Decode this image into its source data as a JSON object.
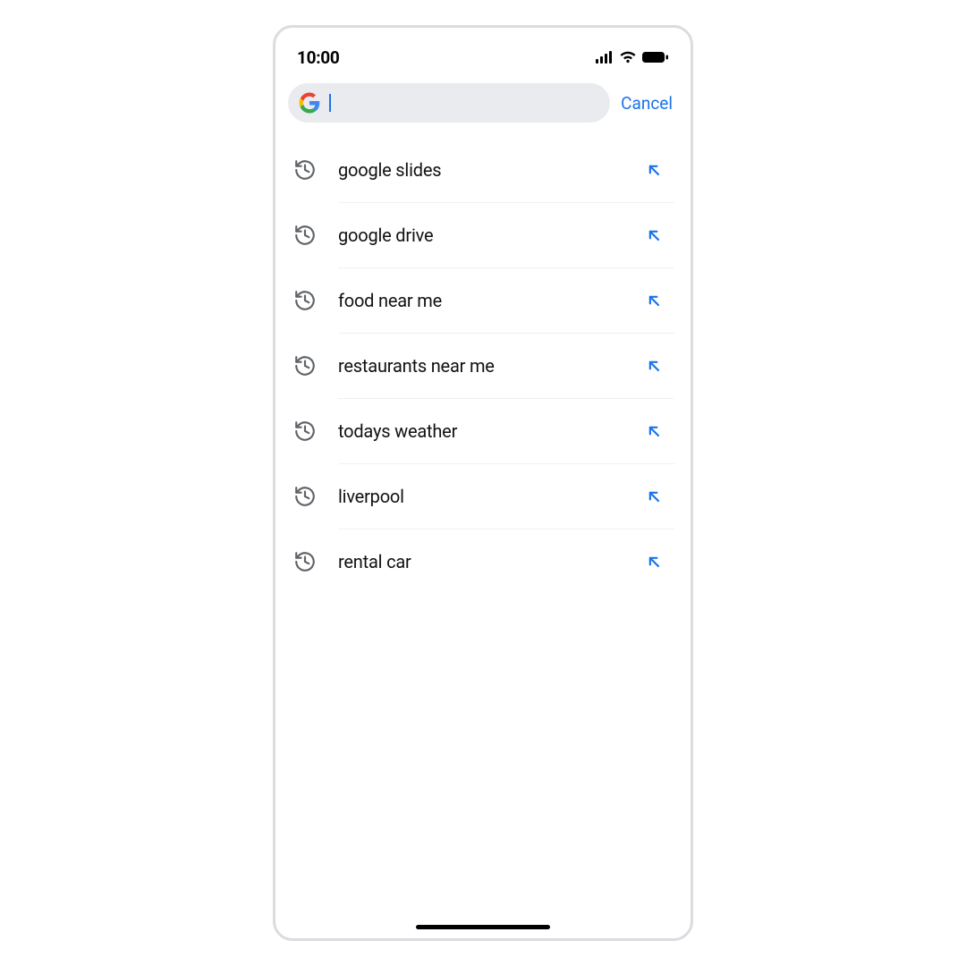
{
  "status": {
    "time": "10:00"
  },
  "search": {
    "placeholder": "",
    "value": "",
    "cancel_label": "Cancel"
  },
  "colors": {
    "accent": "#1a73e8",
    "icon_muted": "#5f6368",
    "pill_bg": "#e9ebee"
  },
  "suggestions": [
    {
      "label": "google slides"
    },
    {
      "label": "google drive"
    },
    {
      "label": "food near me"
    },
    {
      "label": "restaurants near me"
    },
    {
      "label": "todays weather"
    },
    {
      "label": "liverpool"
    },
    {
      "label": "rental car"
    }
  ]
}
